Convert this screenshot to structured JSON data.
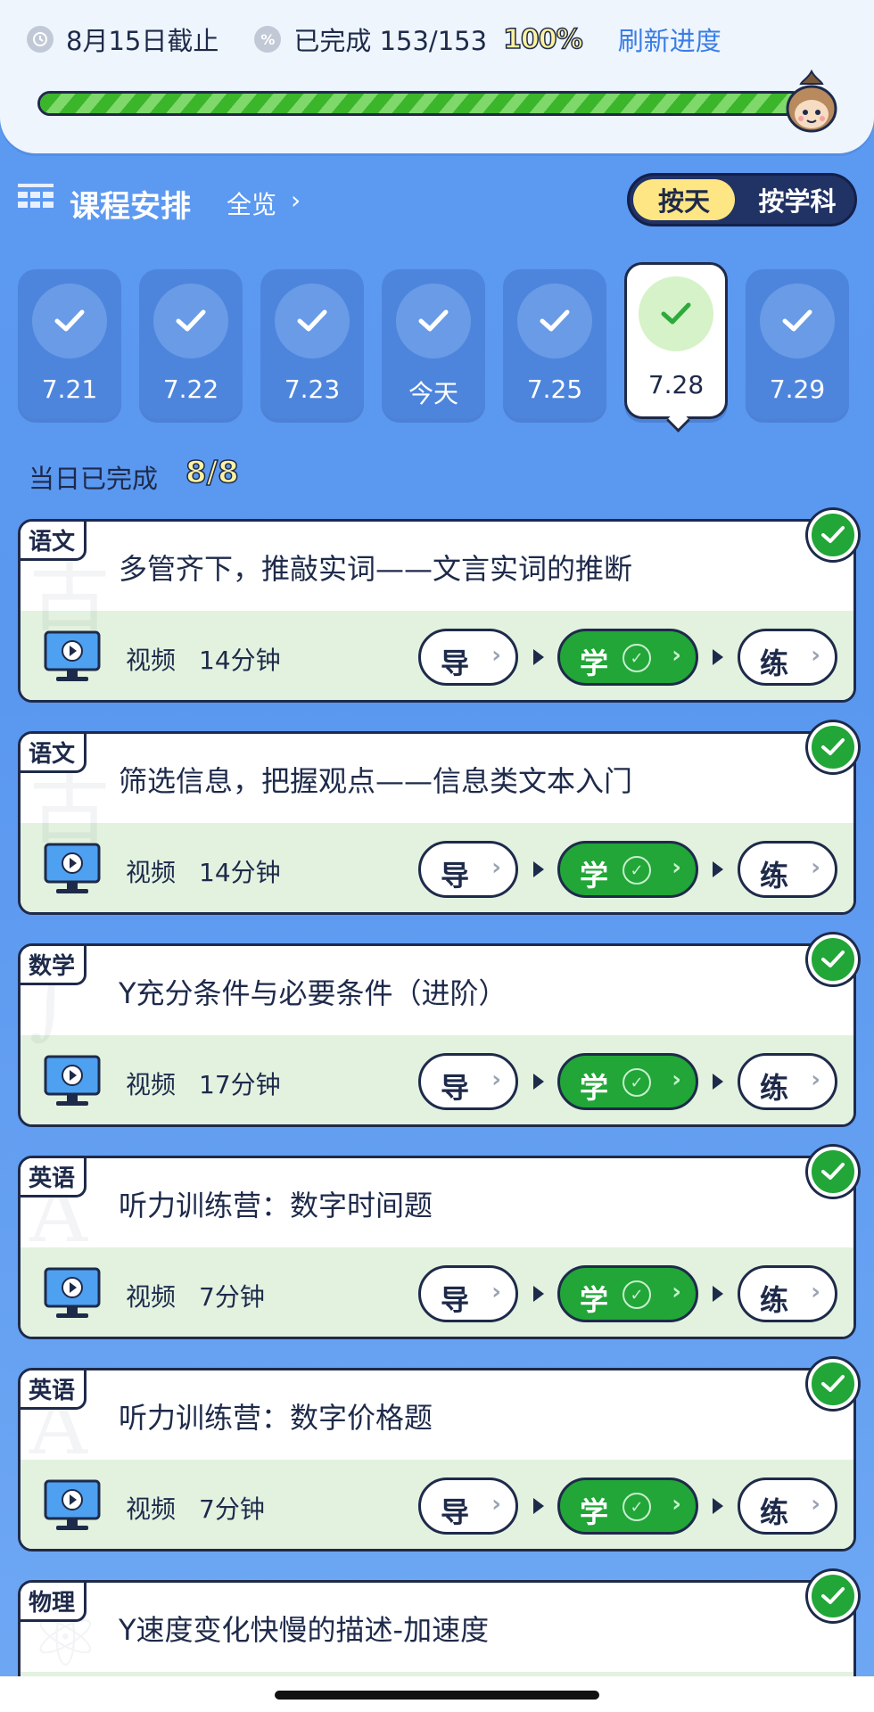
{
  "status": {
    "deadline": "8月15日截止",
    "completed": "已完成 153/153",
    "percent_label": "100%",
    "progress": 1.0,
    "refresh": "刷新进度"
  },
  "section": {
    "title": "课程安排",
    "overview": "全览",
    "toggle_day": "按天",
    "toggle_subject": "按学科"
  },
  "days": [
    {
      "label": "7.21",
      "done": true
    },
    {
      "label": "7.22",
      "done": true
    },
    {
      "label": "7.23",
      "done": true
    },
    {
      "label": "今天",
      "done": true
    },
    {
      "label": "7.25",
      "done": true
    },
    {
      "label": "7.28",
      "done": true,
      "selected": true
    },
    {
      "label": "7.29",
      "done": true
    }
  ],
  "day_status": {
    "label": "当日已完成",
    "count": "8/8"
  },
  "steps": {
    "guide": "导",
    "learn": "学",
    "practice": "练"
  },
  "lessons": [
    {
      "subject": "语文",
      "title": "多管齐下，推敲实词——文言实词的推断",
      "type": "视频",
      "duration": "14分钟"
    },
    {
      "subject": "语文",
      "title": "筛选信息，把握观点——信息类文本入门",
      "type": "视频",
      "duration": "14分钟"
    },
    {
      "subject": "数学",
      "title": "Y充分条件与必要条件（进阶）",
      "type": "视频",
      "duration": "17分钟"
    },
    {
      "subject": "英语",
      "title": "听力训练营：数字时间题",
      "type": "视频",
      "duration": "7分钟"
    },
    {
      "subject": "英语",
      "title": "听力训练营：数字价格题",
      "type": "视频",
      "duration": "7分钟"
    },
    {
      "subject": "物理",
      "title": "Y速度变化快慢的描述-加速度",
      "type": "",
      "duration": ""
    }
  ],
  "colors": {
    "accent": "#21a637",
    "background": "#5d9af2",
    "ink": "#1e2a4a",
    "highlight": "#ffe684"
  }
}
